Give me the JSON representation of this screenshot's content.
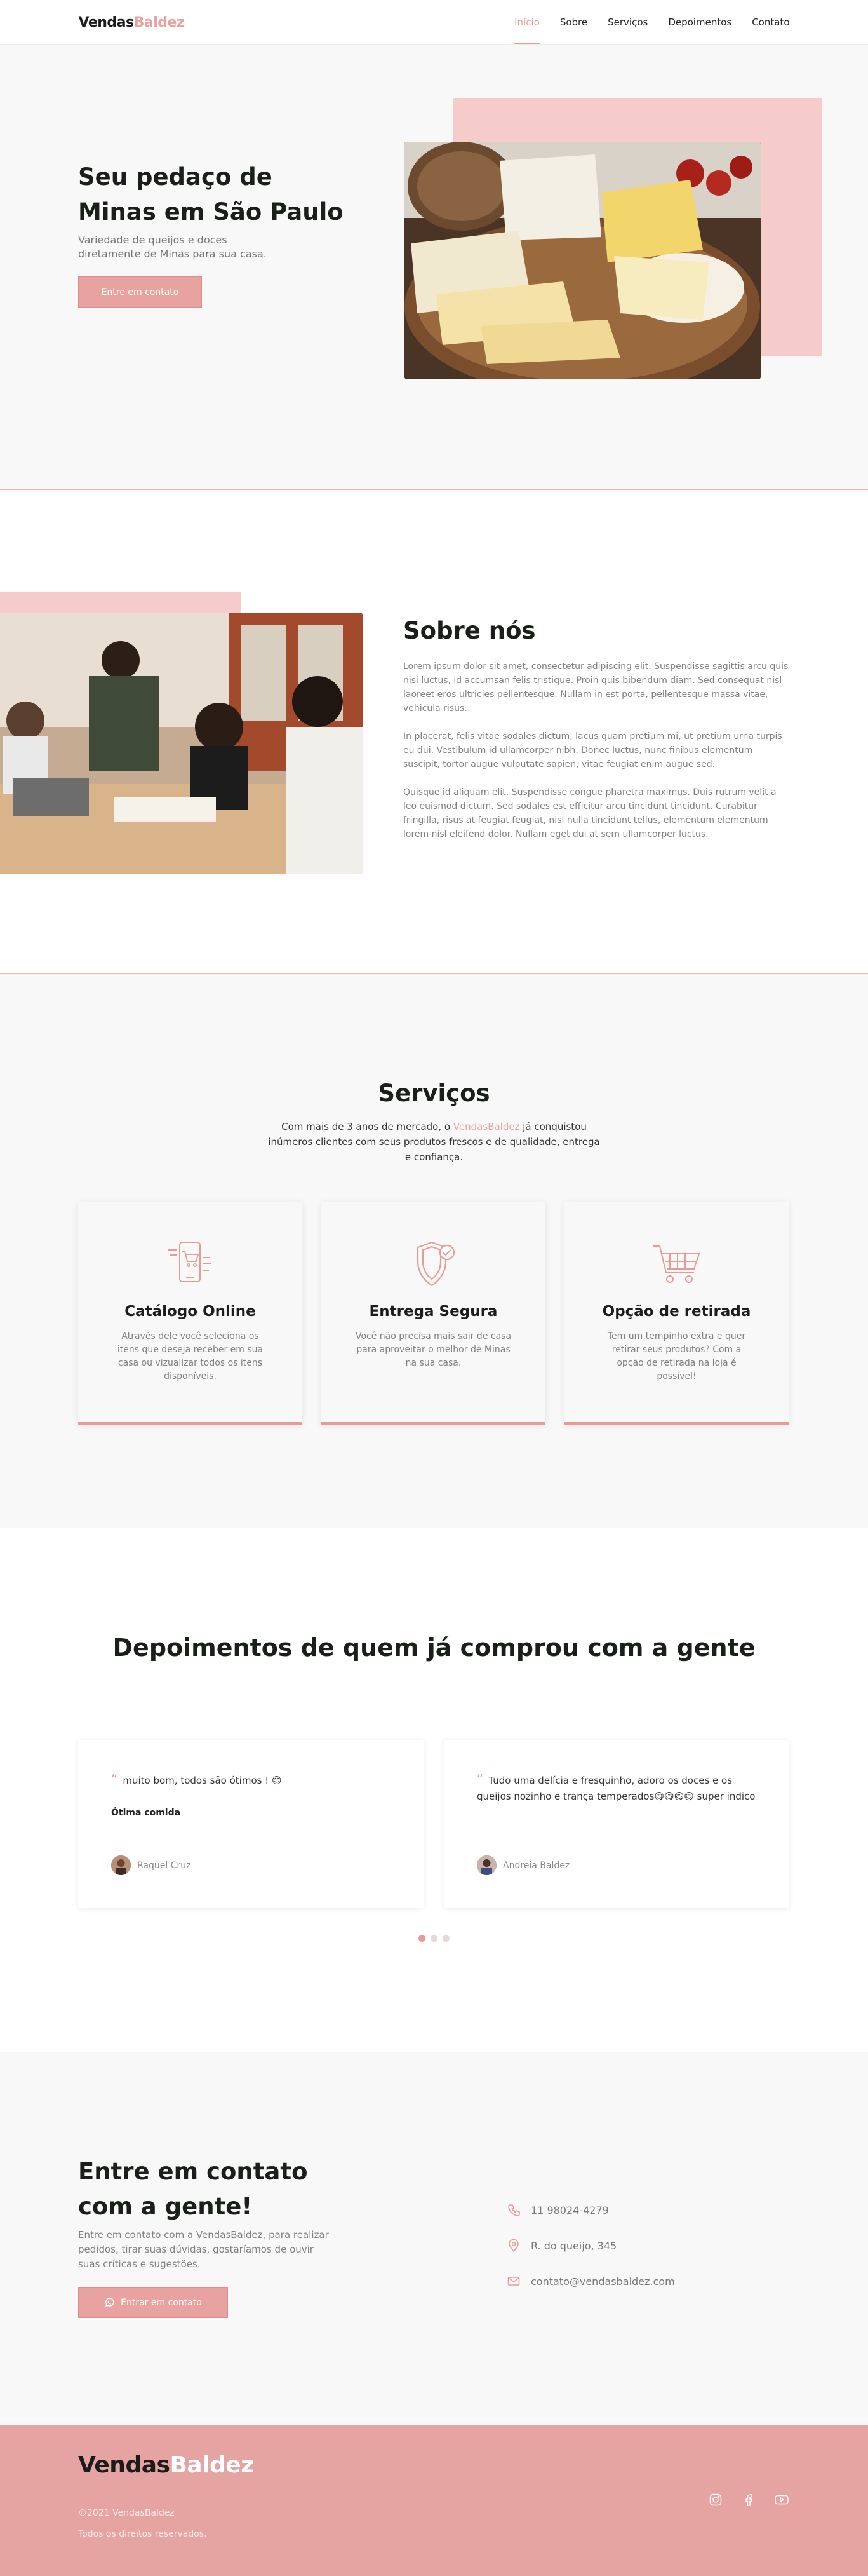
{
  "brand": {
    "part1": "Vendas",
    "part2": "Baldez"
  },
  "nav": [
    {
      "label": "Início",
      "active": true
    },
    {
      "label": "Sobre"
    },
    {
      "label": "Serviços"
    },
    {
      "label": "Depoimentos"
    },
    {
      "label": "Contato"
    }
  ],
  "hero": {
    "title": "Seu pedaço de Minas em São Paulo",
    "subtitle": "Variedade de queijos e doces diretamente de Minas para sua casa.",
    "button": "Entre em contato"
  },
  "about": {
    "title": "Sobre nós",
    "paragraphs": [
      "Lorem ipsum dolor sit amet, consectetur adipiscing elit. Suspendisse sagittis arcu quis nisi luctus, id accumsan felis tristique. Proin quis bibendum diam. Sed consequat nisl laoreet eros ultricies pellentesque. Nullam in est porta, pellentesque massa vitae, vehicula risus.",
      "In placerat, felis vitae sodales dictum, lacus quam pretium mi, ut pretium urna turpis eu dui. Vestibulum id ullamcorper nibh. Donec luctus, nunc finibus elementum suscipit, tortor augue vulputate sapien, vitae feugiat enim augue sed.",
      "Quisque id aliquam elit. Suspendisse congue pharetra maximus. Duis rutrum velit a leo euismod dictum. Sed sodales est efficitur arcu tincidunt tincidunt. Curabitur fringilla, risus at feugiat feugiat, nisl nulla tincidunt tellus, elementum elementum lorem nisl eleifend dolor. Nullam eget dui at sem ullamcorper luctus."
    ]
  },
  "services": {
    "title": "Serviços",
    "lead_before": "Com mais de 3 anos de mercado, o ",
    "lead_highlight": "VendasBaldez",
    "lead_after": " já conquistou inúmeros clientes com seus produtos frescos e de qualidade, entrega e confiança.",
    "cards": [
      {
        "icon": "phone-cart-icon",
        "title": "Catálogo Online",
        "text": "Através dele você seleciona os itens que deseja receber em sua casa ou vizualizar todos os itens disponíveis."
      },
      {
        "icon": "shield-check-icon",
        "title": "Entrega Segura",
        "text": "Você não precisa mais sair de casa para aproveitar o melhor de Minas na sua casa."
      },
      {
        "icon": "shopping-cart-icon",
        "title": "Opção de retirada",
        "text": "Tem um tempinho extra e quer retirar seus produtos? Com a opção de retirada na loja é possível!"
      }
    ]
  },
  "testimonials": {
    "title": "Depoimentos de quem já comprou com a gente",
    "items": [
      {
        "quote": "muito bom, todos são ótimos ! 😊",
        "title": "Ótima comida",
        "author": "Raquel Cruz"
      },
      {
        "quote": "Tudo uma delícia e fresquinho, adoro os doces e os queijos nozinho e trança temperados😋😋😋😋 super indico",
        "title": "",
        "author": "Andreia Baldez"
      }
    ]
  },
  "contact": {
    "title": "Entre em contato com a gente!",
    "text": "Entre em contato com a VendasBaldez, para realizar pedidos, tirar suas dúvidas, gostaríamos de ouvir suas críticas e sugestões.",
    "button": "Entrar em contato",
    "phone": "11 98024-4279",
    "address": "R. do queijo, 345",
    "email": "contato@vendasbaldez.com"
  },
  "footer": {
    "copyright": "©2021 VendasBaldez",
    "rights": "Todos os direitos reservados."
  },
  "colors": {
    "accent": "#e8a3a1",
    "pink_block": "#f6ccca",
    "footer_bg": "#e5a4a2",
    "heading": "#1a1f1a"
  }
}
